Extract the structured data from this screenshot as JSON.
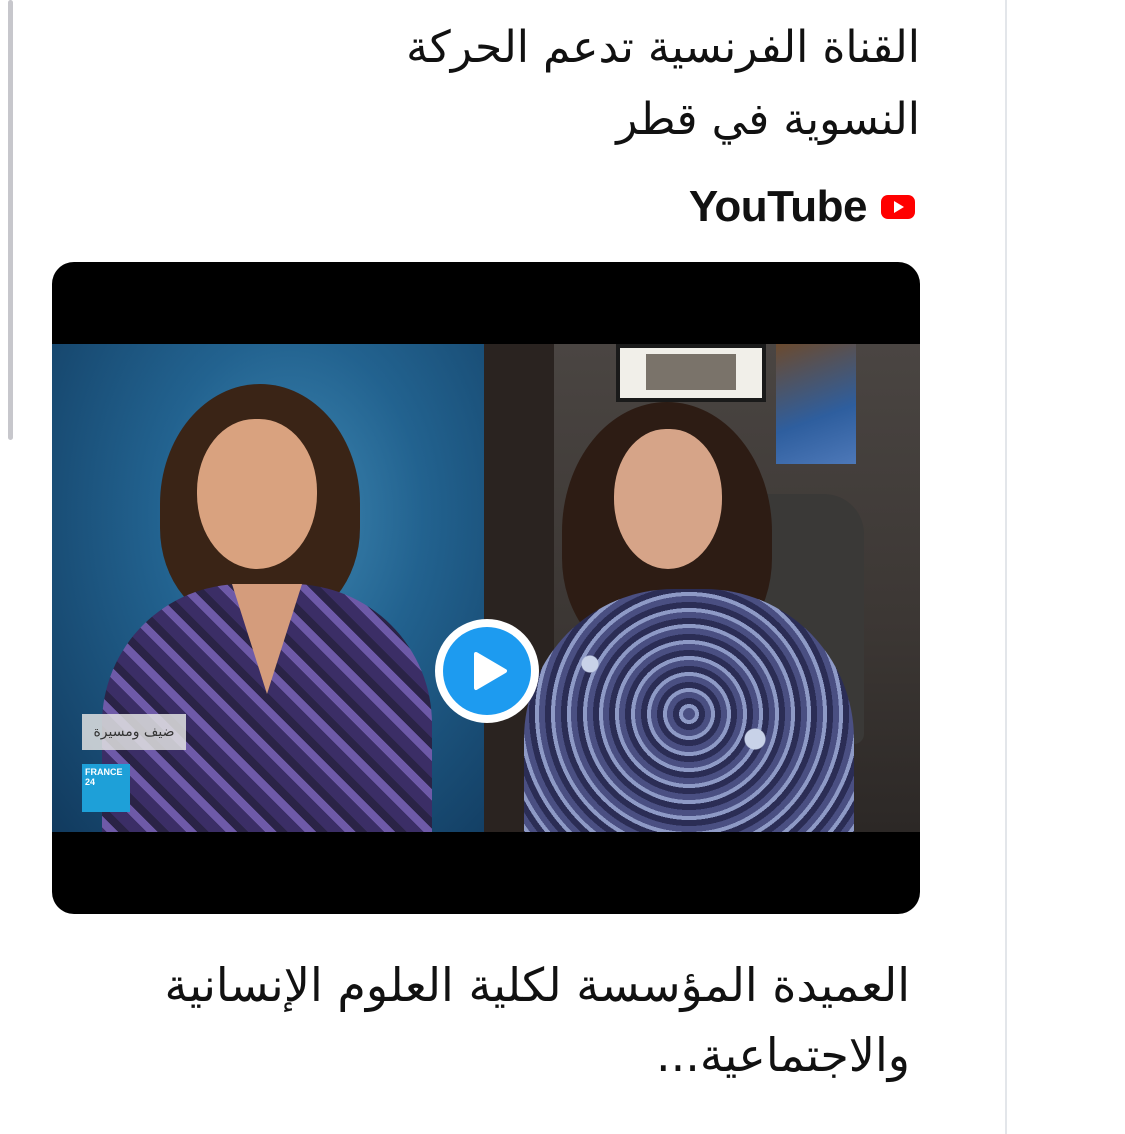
{
  "tweet": {
    "text": "القناة الفرنسية تدعم الحركة النسوية في قطر"
  },
  "card": {
    "source": "YouTube",
    "source_icon": "youtube-icon",
    "title": "العميدة المؤسسة لكلية العلوم الإنسانية والاجتماعية...",
    "play_icon": "play-icon",
    "accent_color": "#1d9bf0",
    "thumbnail": {
      "show_logo_text": "ضيف ومسيرة",
      "channel_logo": "FRANCE 24"
    }
  }
}
